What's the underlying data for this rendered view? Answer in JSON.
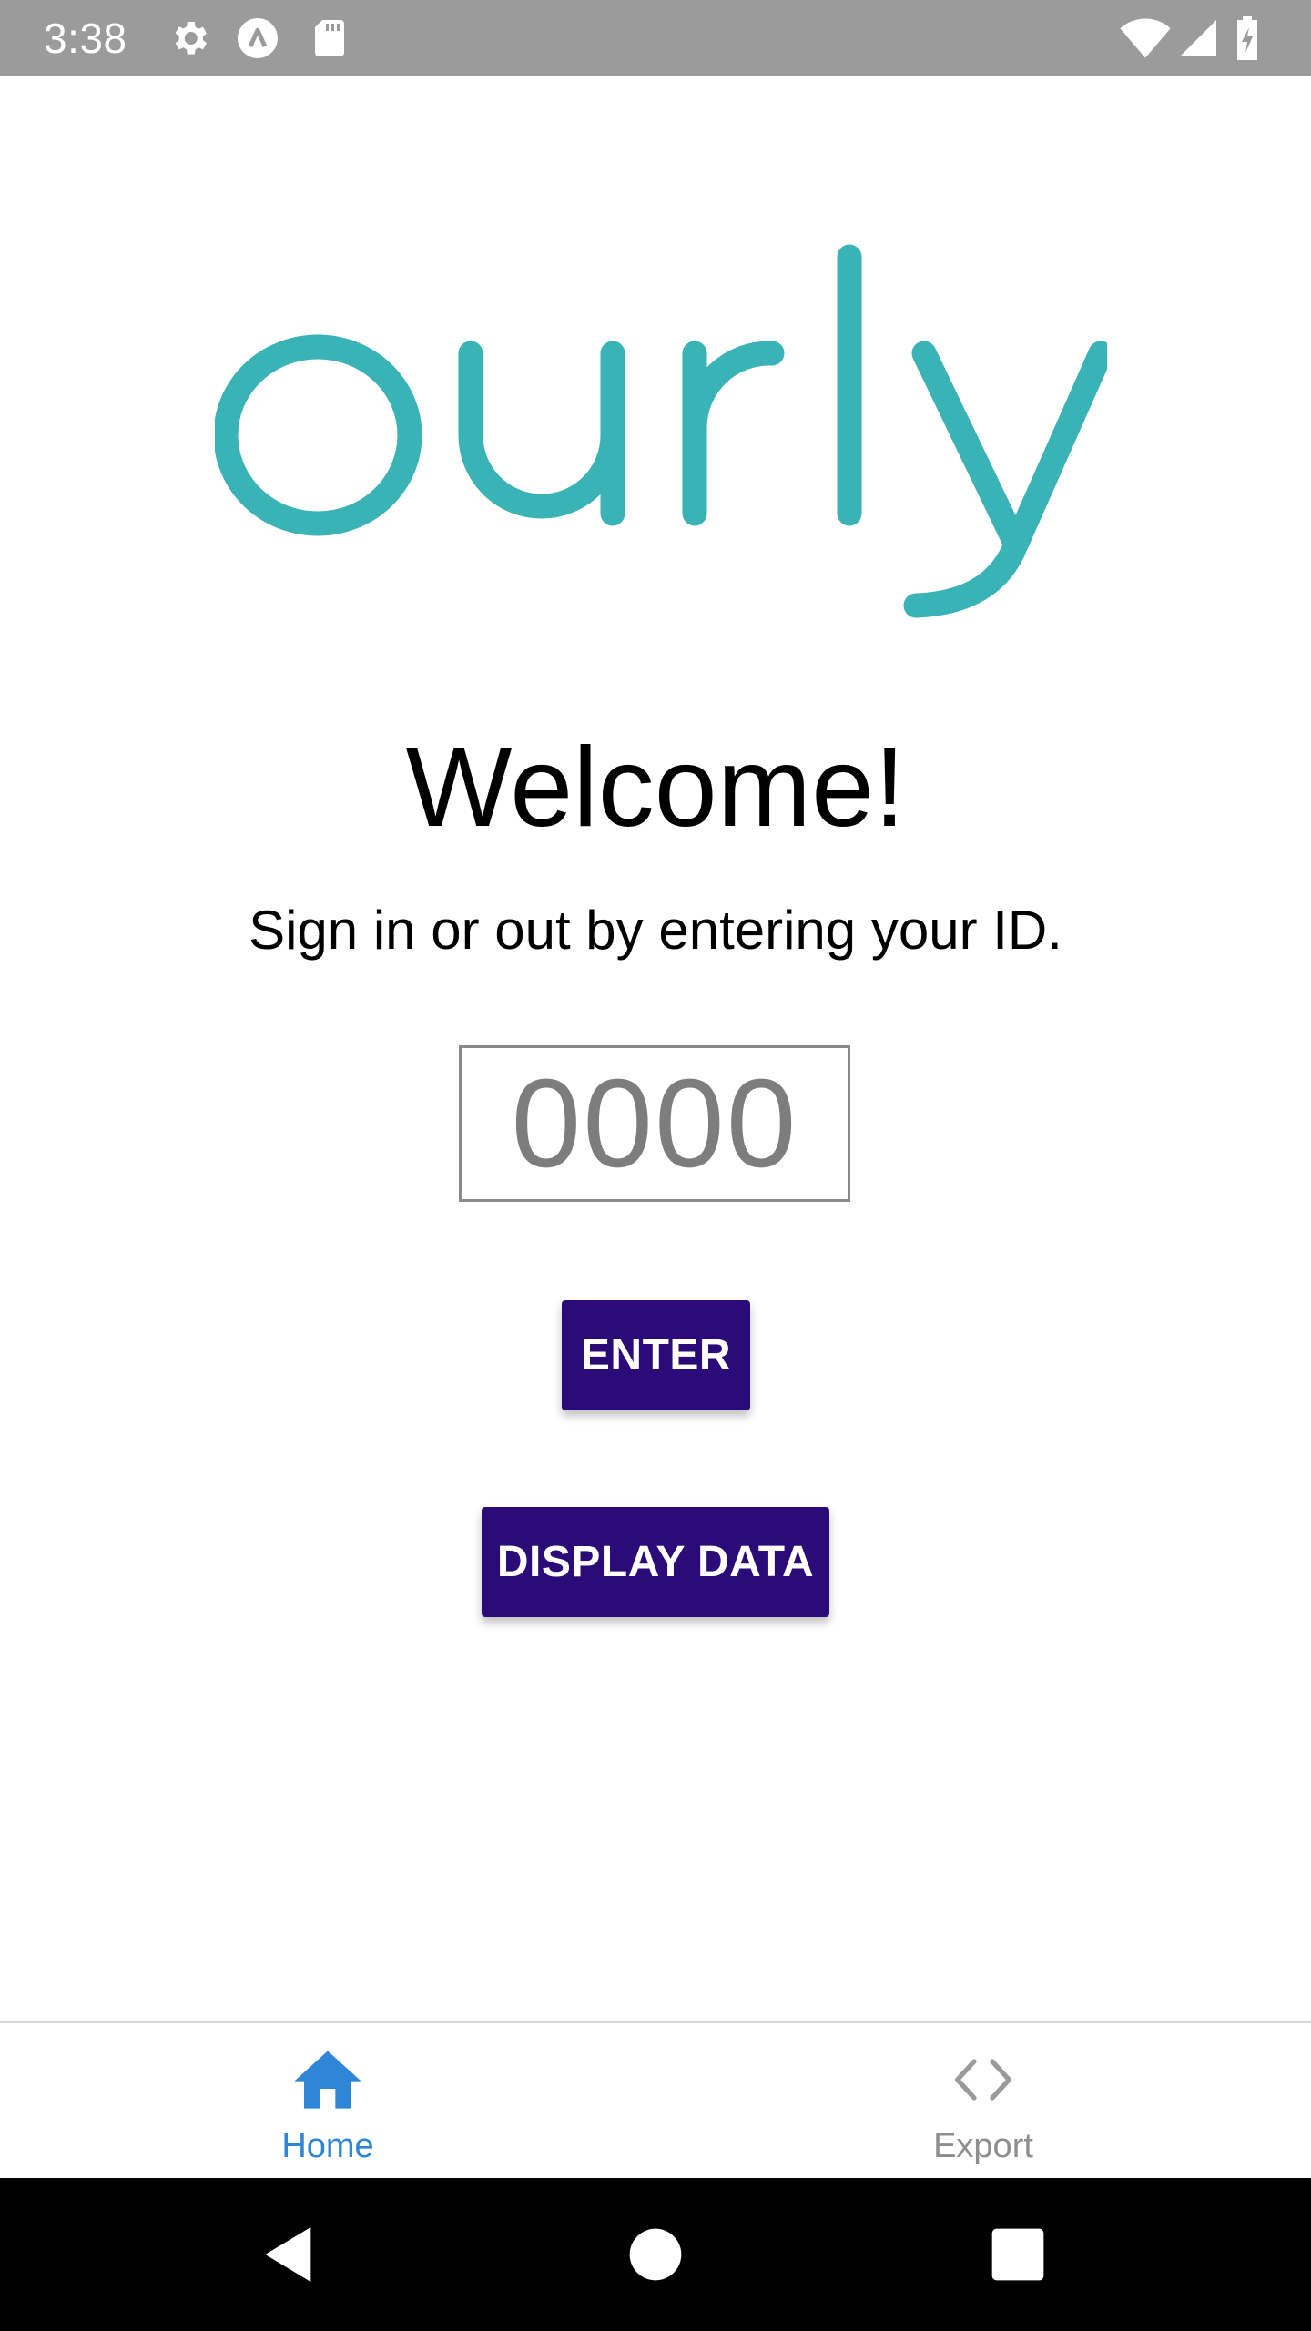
{
  "status_bar": {
    "time": "3:38",
    "left_icons": [
      "settings-icon",
      "app-icon",
      "sd-card-icon"
    ],
    "right_icons": [
      "wifi-icon",
      "signal-icon",
      "battery-charging-icon"
    ]
  },
  "logo": {
    "text": "ourly",
    "color": "#3ab3b6"
  },
  "main": {
    "title": "Welcome!",
    "subtitle": "Sign in or out by entering your ID.",
    "id_input": {
      "placeholder": "0000",
      "value": ""
    },
    "enter_label": "ENTER",
    "display_data_label": "DISPLAY DATA",
    "button_color": "#2a0b78"
  },
  "tab_bar": {
    "tabs": [
      {
        "label": "Home",
        "icon": "home-icon",
        "active": true,
        "color": "#2f86d6"
      },
      {
        "label": "Export",
        "icon": "code-icon",
        "active": false,
        "color": "#8e8e8e"
      }
    ]
  },
  "nav_bar": {
    "buttons": [
      "back-icon",
      "home-circle-icon",
      "recents-icon"
    ]
  }
}
